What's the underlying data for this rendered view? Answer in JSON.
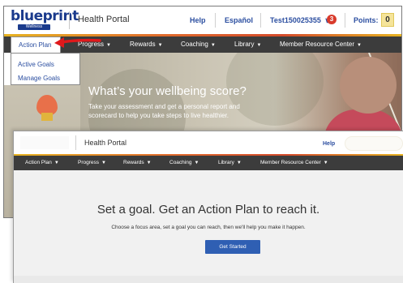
{
  "back_window": {
    "logo": {
      "word": "blueprint",
      "subtitle": "Wellness"
    },
    "header": {
      "title": "Health Portal",
      "help": "Help",
      "espanol": "Español",
      "user": "Test150025355",
      "user_chevron": "∨",
      "notification_count": "3",
      "points_label": "Points:",
      "points_value": "0"
    },
    "nav": [
      {
        "label": "Action Plan",
        "chevron": "▼"
      },
      {
        "label": "Progress"
      },
      {
        "label": "Rewards"
      },
      {
        "label": "Coaching"
      },
      {
        "label": "Library"
      },
      {
        "label": "Member Resource Center"
      }
    ],
    "dropdown": [
      "Active Goals",
      "Manage Goals"
    ],
    "hero": {
      "title": "What’s your wellbeing score?",
      "subtitle_line1": "Take your assessment and get a personal report and",
      "subtitle_line2": "scorecard to help you take steps to live healthier."
    }
  },
  "front_window": {
    "header": {
      "title": "Health Portal",
      "help": "Help"
    },
    "nav": [
      {
        "label": "Action Plan"
      },
      {
        "label": "Progress"
      },
      {
        "label": "Rewards"
      },
      {
        "label": "Coaching"
      },
      {
        "label": "Library"
      },
      {
        "label": "Member Resource Center"
      }
    ],
    "heading": "Set a goal. Get an Action Plan to reach it.",
    "description": "Choose a focus area, set a goal you can reach, then we'll help you make it happen.",
    "button": "Get Started"
  },
  "colors": {
    "brand_blue": "#2b4ea0",
    "nav_bg": "#3c3c3c",
    "accent_orange": "#e06b2c",
    "badge_red": "#d93a2b",
    "points_bg": "#f5e49a",
    "button_blue": "#2f5fb3",
    "annotation_arrow": "#e0191c"
  },
  "icons": {
    "nav_chevron": "chevron-down-icon",
    "notification": "notification-badge",
    "annotation": "red-arrow-icon"
  }
}
